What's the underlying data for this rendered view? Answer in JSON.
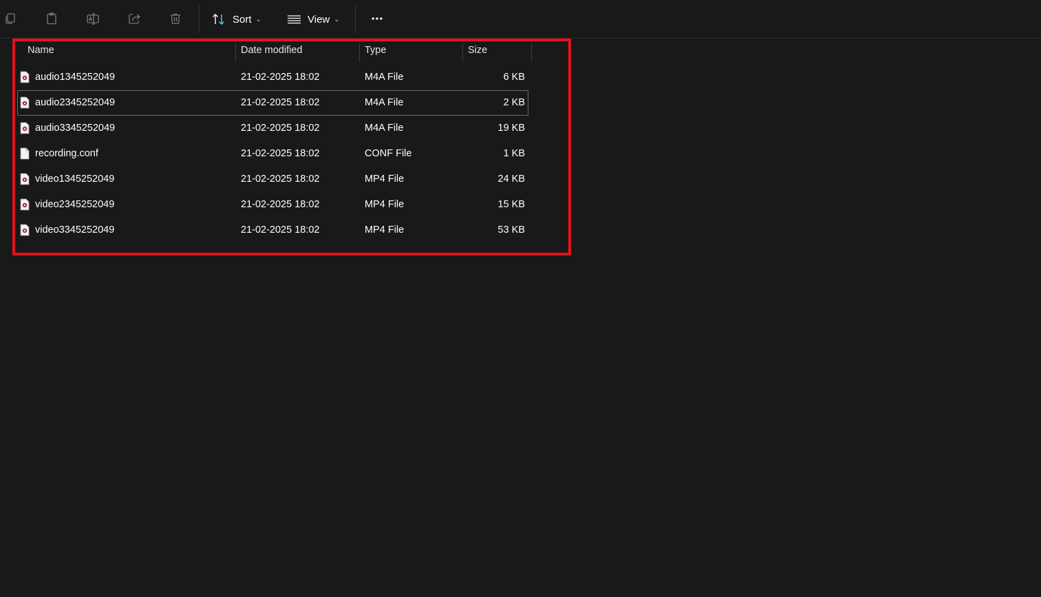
{
  "toolbar": {
    "sort_label": "Sort",
    "view_label": "View",
    "icons": [
      "copy-icon",
      "paste-icon",
      "rename-icon",
      "share-icon",
      "delete-icon",
      "sort-icon",
      "view-icon",
      "more-icon"
    ]
  },
  "columns": {
    "name": "Name",
    "date": "Date modified",
    "type": "Type",
    "size": "Size"
  },
  "files": [
    {
      "name": "audio1345252049",
      "date": "21-02-2025 18:02",
      "type": "M4A File",
      "size": "6 KB",
      "icon": "media-file-icon"
    },
    {
      "name": "audio2345252049",
      "date": "21-02-2025 18:02",
      "type": "M4A File",
      "size": "2 KB",
      "icon": "media-file-icon"
    },
    {
      "name": "audio3345252049",
      "date": "21-02-2025 18:02",
      "type": "M4A File",
      "size": "19 KB",
      "icon": "media-file-icon"
    },
    {
      "name": "recording.conf",
      "date": "21-02-2025 18:02",
      "type": "CONF File",
      "size": "1 KB",
      "icon": "blank-file-icon"
    },
    {
      "name": "video1345252049",
      "date": "21-02-2025 18:02",
      "type": "MP4 File",
      "size": "24 KB",
      "icon": "media-file-icon"
    },
    {
      "name": "video2345252049",
      "date": "21-02-2025 18:02",
      "type": "MP4 File",
      "size": "15 KB",
      "icon": "media-file-icon"
    },
    {
      "name": "video3345252049",
      "date": "21-02-2025 18:02",
      "type": "MP4 File",
      "size": "53 KB",
      "icon": "media-file-icon"
    }
  ],
  "colors": {
    "background": "#191919",
    "highlight": "#e3131e",
    "accent": "#60cdff"
  }
}
